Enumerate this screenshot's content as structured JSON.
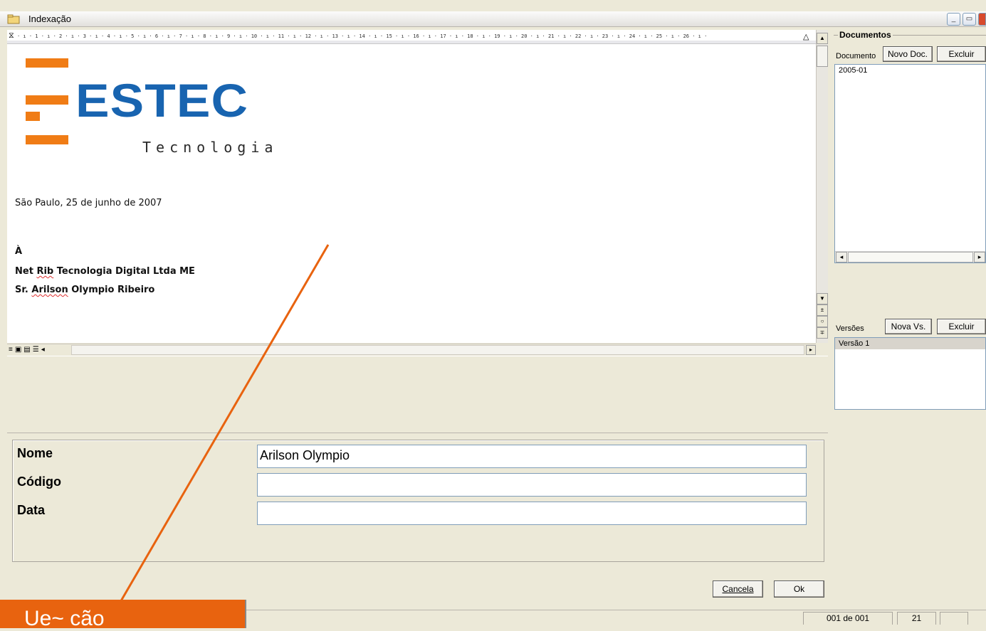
{
  "window": {
    "title": "Indexação",
    "min": "_",
    "restore": "▭",
    "close": "X"
  },
  "ruler": {
    "ticks": "· ı · 1 · ı · 2 · ı · 3 · ı · 4 · ı · 5 · ı · 6 · ı · 7 · ı · 8 · ı · 9 · ı · 10 · ı · 11 · ı · 12 · ı · 13 · ı · 14 · ı · 15 · ı · 16 · ı · 17 · ı · 18 · ı · 19 · ı · 20 · ı · 21 · ı · 22 · ı · 23 · ı · 24 · ı · 25 · ı · 26 · ı ·"
  },
  "document": {
    "logo": {
      "word": "ESTEC",
      "sub": "Tecnologia"
    },
    "date_line": "São Paulo, 25 de junho de 2007",
    "salutation": "À",
    "company": {
      "pre": "Net ",
      "squig": "Rib",
      "post": " Tecnologia Digital Ltda ME"
    },
    "person": {
      "pre": "Sr. ",
      "squig": "Arilson",
      "post": " Olympio Ribeiro"
    }
  },
  "form": {
    "fields": [
      {
        "label": "Nome",
        "value": "Arilson Olympio"
      },
      {
        "label": "Código",
        "value": ""
      },
      {
        "label": "Data",
        "value": ""
      }
    ],
    "cancel_label": "Cancela",
    "ok_label": "Ok"
  },
  "documents": {
    "group_title": "Documentos",
    "label": "Documento",
    "new_button": "Novo Doc.",
    "delete_button": "Excluir",
    "items": [
      "2005-01"
    ]
  },
  "versions": {
    "label": "Versões",
    "new_button": "Nova Vs.",
    "delete_button": "Excluir",
    "items": [
      "Versão 1"
    ]
  },
  "status": {
    "page": "001 de 001",
    "count": "21"
  },
  "callout": {
    "text": "Ue~ cão"
  },
  "colors": {
    "accent": "#e8630f",
    "logo_blue": "#1864b0",
    "logo_orange": "#f07c15"
  }
}
